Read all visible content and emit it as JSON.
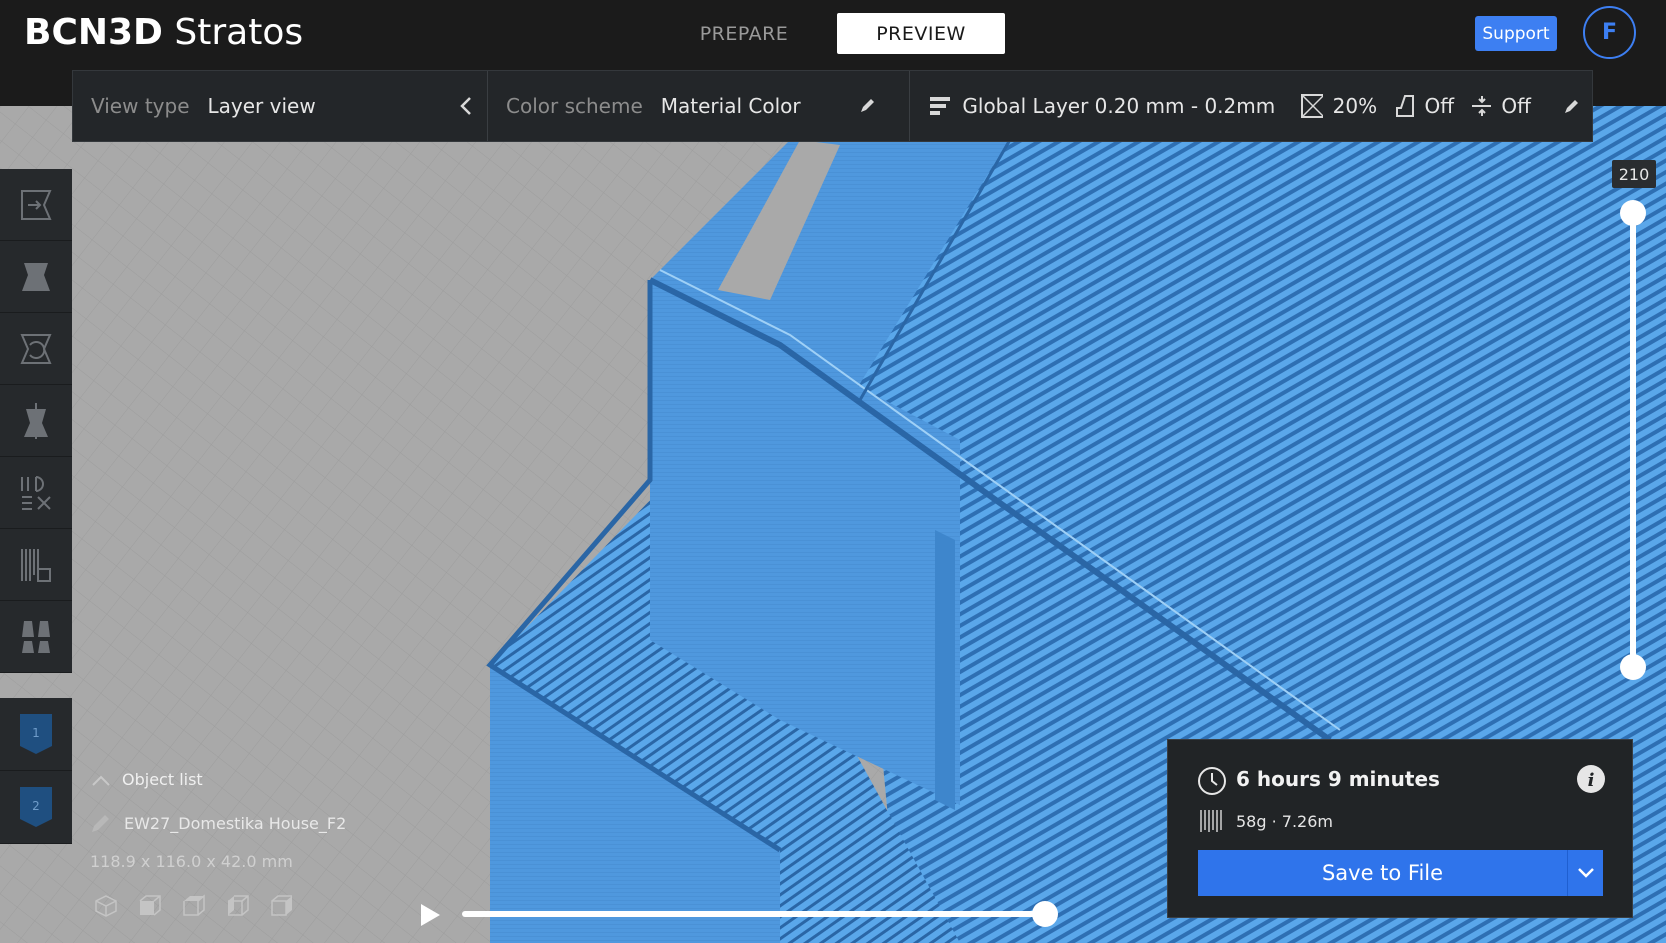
{
  "app": {
    "brand_bold": "BCN3D",
    "brand_light": "Stratos"
  },
  "header": {
    "tabs": [
      {
        "label": "PREPARE"
      },
      {
        "label": "PREVIEW"
      }
    ],
    "support_label": "Support",
    "avatar_initial": "F"
  },
  "toolbar": {
    "view_type_label": "View type",
    "view_type_value": "Layer view",
    "color_scheme_label": "Color scheme",
    "color_scheme_value": "Material Color",
    "profile": "Global Layer 0.20 mm - 0.2mm",
    "infill": "20%",
    "support": "Off",
    "adhesion": "Off"
  },
  "extruders": [
    {
      "number": "1"
    },
    {
      "number": "2"
    }
  ],
  "object_panel": {
    "list_label": "Object list",
    "object_name": "EW27_Domestika House_F2",
    "dimensions": "118.9 x 116.0 x 42.0 mm"
  },
  "layer_slider": {
    "current_layer": "210",
    "top_fraction": 1.0,
    "bottom_fraction": 0.0
  },
  "simulation": {
    "progress_fraction": 1.0
  },
  "estimate": {
    "time": "6 hours 9 minutes",
    "material": "58g · 7.26m",
    "save_label": "Save to File"
  },
  "colors": {
    "accent": "#2f74eb",
    "filament": "#5aa7ea",
    "bed": "#a9a9a9",
    "panel": "#232629"
  }
}
